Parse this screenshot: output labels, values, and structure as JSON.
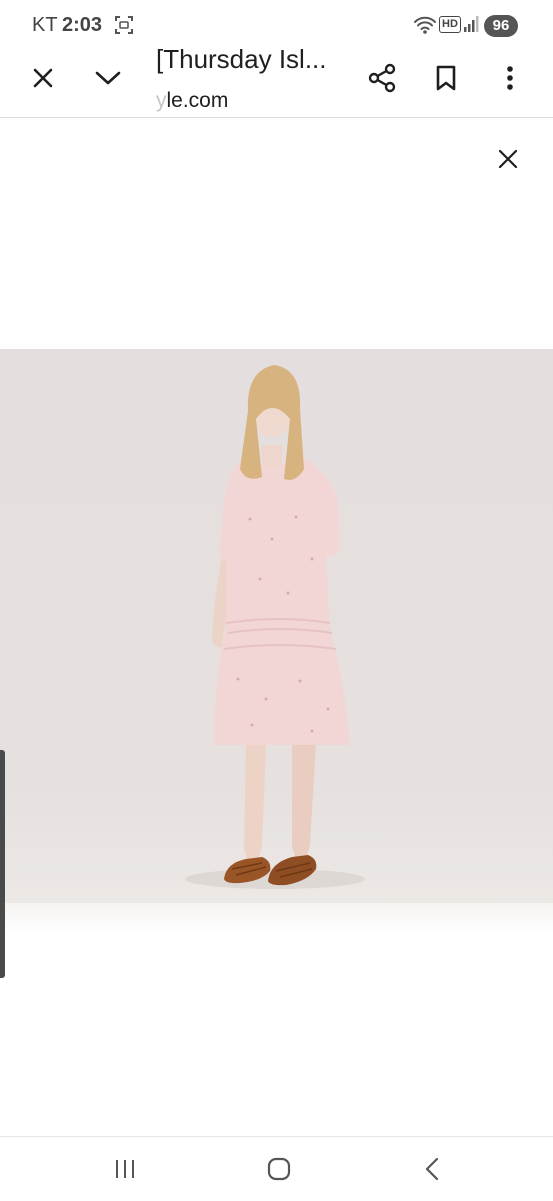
{
  "status_bar": {
    "carrier": "KT",
    "time": "2:03",
    "network_badge": "HD",
    "battery": "96"
  },
  "toolbar": {
    "title": "[Thursday Isl...",
    "url_faded": "y",
    "url": "le.com"
  },
  "icons": {
    "close": "close-icon",
    "minimize": "chevron-down-icon",
    "share": "share-icon",
    "bookmark": "bookmark-icon",
    "more": "more-vert-icon",
    "viewer_close": "close-icon",
    "recents": "recents-icon",
    "home": "home-icon",
    "back": "back-icon"
  },
  "colors": {
    "photo_background": "#e5dfdd",
    "dress": "#f2d6d6",
    "sandals": "#9a5527"
  }
}
